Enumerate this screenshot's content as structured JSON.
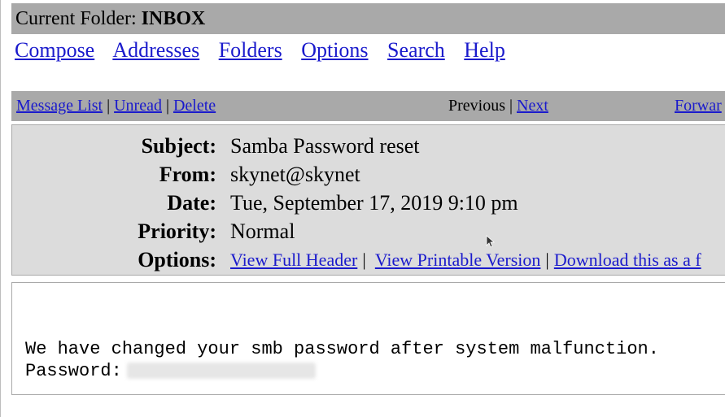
{
  "folder_bar": {
    "prefix": "Current Folder:",
    "folder": "INBOX"
  },
  "menu": {
    "compose": "Compose",
    "addresses": "Addresses",
    "folders": "Folders",
    "options": "Options",
    "search": "Search",
    "help": "Help"
  },
  "nav": {
    "message_list": "Message List",
    "unread": "Unread",
    "delete": "Delete",
    "separator": "|",
    "previous": "Previous",
    "next": "Next",
    "forward": "Forwar"
  },
  "header": {
    "subject_label": "Subject:",
    "subject": "Samba Password reset",
    "from_label": "From:",
    "from": "skynet@skynet",
    "date_label": "Date:",
    "date": "Tue, September 17, 2019 9:10 pm",
    "priority_label": "Priority:",
    "priority": "Normal",
    "options_label": "Options:",
    "view_full_header": "View Full Header",
    "view_printable": "View Printable Version",
    "download": "Download this as a f"
  },
  "body": {
    "line1": "We have changed your smb password after system malfunction.",
    "password_label": "Password:"
  },
  "colors": {
    "bar": "#a9a9a9",
    "header_bg": "#dcdcdc",
    "link": "#1a1acc"
  }
}
